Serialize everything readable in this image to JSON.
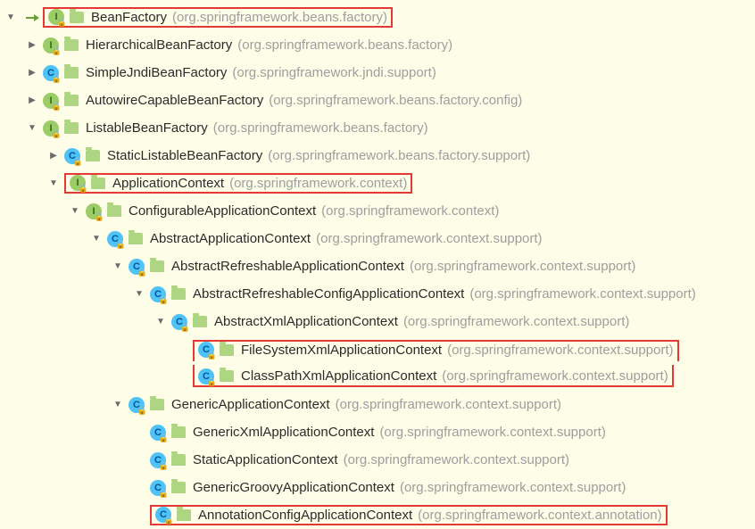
{
  "rows": [
    {
      "depth": 0,
      "chevron": "down",
      "leadArrow": true,
      "kind": "interface",
      "name": "BeanFactory",
      "pkg": "(org.springframework.beans.factory)",
      "highlight": true
    },
    {
      "depth": 1,
      "chevron": "right",
      "kind": "interface",
      "name": "HierarchicalBeanFactory",
      "pkg": "(org.springframework.beans.factory)"
    },
    {
      "depth": 1,
      "chevron": "right",
      "kind": "class",
      "name": "SimpleJndiBeanFactory",
      "pkg": "(org.springframework.jndi.support)"
    },
    {
      "depth": 1,
      "chevron": "right",
      "kind": "interface",
      "name": "AutowireCapableBeanFactory",
      "pkg": "(org.springframework.beans.factory.config)"
    },
    {
      "depth": 1,
      "chevron": "down",
      "kind": "interface",
      "name": "ListableBeanFactory",
      "pkg": "(org.springframework.beans.factory)"
    },
    {
      "depth": 2,
      "chevron": "right",
      "kind": "class",
      "name": "StaticListableBeanFactory",
      "pkg": "(org.springframework.beans.factory.support)"
    },
    {
      "depth": 2,
      "chevron": "down",
      "kind": "interface",
      "name": "ApplicationContext",
      "pkg": "(org.springframework.context)",
      "highlight": true
    },
    {
      "depth": 3,
      "chevron": "down",
      "kind": "interface",
      "name": "ConfigurableApplicationContext",
      "pkg": "(org.springframework.context)"
    },
    {
      "depth": 4,
      "chevron": "down",
      "kind": "class",
      "name": "AbstractApplicationContext",
      "pkg": "(org.springframework.context.support)"
    },
    {
      "depth": 5,
      "chevron": "down",
      "kind": "class",
      "name": "AbstractRefreshableApplicationContext",
      "pkg": "(org.springframework.context.support)"
    },
    {
      "depth": 6,
      "chevron": "down",
      "kind": "class",
      "name": "AbstractRefreshableConfigApplicationContext",
      "pkg": "(org.springframework.context.support)"
    },
    {
      "depth": 7,
      "chevron": "down",
      "kind": "class",
      "name": "AbstractXmlApplicationContext",
      "pkg": "(org.springframework.context.support)"
    },
    {
      "depth": 8,
      "chevron": "none",
      "kind": "class",
      "name": "FileSystemXmlApplicationContext",
      "pkg": "(org.springframework.context.support)",
      "highlight": true,
      "hlInGroup": "top"
    },
    {
      "depth": 8,
      "chevron": "none",
      "kind": "class",
      "name": "ClassPathXmlApplicationContext",
      "pkg": "(org.springframework.context.support)",
      "highlight": true,
      "hlInGroup": "bottom"
    },
    {
      "depth": 5,
      "chevron": "down",
      "kind": "class",
      "name": "GenericApplicationContext",
      "pkg": "(org.springframework.context.support)"
    },
    {
      "depth": 6,
      "chevron": "none",
      "kind": "class",
      "name": "GenericXmlApplicationContext",
      "pkg": "(org.springframework.context.support)"
    },
    {
      "depth": 6,
      "chevron": "none",
      "kind": "class",
      "name": "StaticApplicationContext",
      "pkg": "(org.springframework.context.support)"
    },
    {
      "depth": 6,
      "chevron": "none",
      "kind": "class",
      "name": "GenericGroovyApplicationContext",
      "pkg": "(org.springframework.context.support)"
    },
    {
      "depth": 6,
      "chevron": "none",
      "kind": "class",
      "name": "AnnotationConfigApplicationContext",
      "pkg": "(org.springframework.context.annotation)",
      "highlight": true
    }
  ]
}
